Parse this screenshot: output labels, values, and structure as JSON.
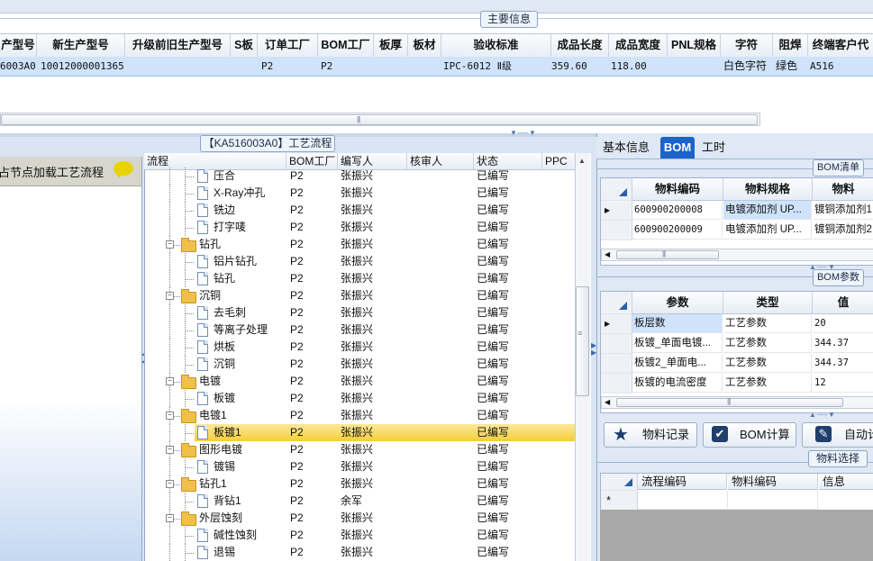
{
  "main_info": {
    "title": "主要信息",
    "columns": [
      "产型号",
      "新生产型号",
      "升级前旧生产型号",
      "S板",
      "订单工厂",
      "BOM工厂",
      "板厚",
      "板材",
      "验收标准",
      "成品长度",
      "成品宽度",
      "PNL规格",
      "字符",
      "阻焊",
      "终端客户代"
    ],
    "row": [
      "6003A0",
      "10012000001365",
      "",
      "",
      "P2",
      "P2",
      "",
      "",
      "IPC-6012 Ⅱ级",
      "359.60",
      "118.00",
      "",
      "白色字符",
      "绿色",
      "A516"
    ]
  },
  "left_nav": {
    "header": "占节点加载工艺流程",
    "chat_icon": "speech-bubble-icon"
  },
  "flow": {
    "title": "【KA516003A0】工艺流程",
    "columns": [
      "流程",
      "BOM工厂",
      "编写人",
      "核审人",
      "状态",
      "PPC"
    ],
    "rows": [
      {
        "name": "压合",
        "level": 2,
        "type": "doc",
        "factory": "P2",
        "author": "张振兴",
        "reviewer": "",
        "status": "已编写"
      },
      {
        "name": "X-Ray冲孔",
        "level": 2,
        "type": "doc",
        "factory": "P2",
        "author": "张振兴",
        "reviewer": "",
        "status": "已编写"
      },
      {
        "name": "铣边",
        "level": 2,
        "type": "doc",
        "factory": "P2",
        "author": "张振兴",
        "reviewer": "",
        "status": "已编写"
      },
      {
        "name": "打字唛",
        "level": 2,
        "type": "doc",
        "factory": "P2",
        "author": "张振兴",
        "reviewer": "",
        "status": "已编写"
      },
      {
        "name": "钻孔",
        "level": 1,
        "type": "folder",
        "factory": "P2",
        "author": "张振兴",
        "reviewer": "",
        "status": "已编写"
      },
      {
        "name": "铝片钻孔",
        "level": 2,
        "type": "doc",
        "factory": "P2",
        "author": "张振兴",
        "reviewer": "",
        "status": "已编写"
      },
      {
        "name": "钻孔",
        "level": 2,
        "type": "doc",
        "factory": "P2",
        "author": "张振兴",
        "reviewer": "",
        "status": "已编写"
      },
      {
        "name": "沉铜",
        "level": 1,
        "type": "folder",
        "factory": "P2",
        "author": "张振兴",
        "reviewer": "",
        "status": "已编写"
      },
      {
        "name": "去毛刺",
        "level": 2,
        "type": "doc",
        "factory": "P2",
        "author": "张振兴",
        "reviewer": "",
        "status": "已编写"
      },
      {
        "name": "等离子处理",
        "level": 2,
        "type": "doc",
        "factory": "P2",
        "author": "张振兴",
        "reviewer": "",
        "status": "已编写"
      },
      {
        "name": "烘板",
        "level": 2,
        "type": "doc",
        "factory": "P2",
        "author": "张振兴",
        "reviewer": "",
        "status": "已编写"
      },
      {
        "name": "沉铜",
        "level": 2,
        "type": "doc",
        "factory": "P2",
        "author": "张振兴",
        "reviewer": "",
        "status": "已编写"
      },
      {
        "name": "电镀",
        "level": 1,
        "type": "folder",
        "factory": "P2",
        "author": "张振兴",
        "reviewer": "",
        "status": "已编写"
      },
      {
        "name": "板镀",
        "level": 2,
        "type": "doc",
        "factory": "P2",
        "author": "张振兴",
        "reviewer": "",
        "status": "已编写"
      },
      {
        "name": "电镀1",
        "level": 1,
        "type": "folder",
        "factory": "P2",
        "author": "张振兴",
        "reviewer": "",
        "status": "已编写"
      },
      {
        "name": "板镀1",
        "level": 2,
        "type": "doc",
        "factory": "P2",
        "author": "张振兴",
        "reviewer": "",
        "status": "已编写",
        "selected": true
      },
      {
        "name": "图形电镀",
        "level": 1,
        "type": "folder",
        "factory": "P2",
        "author": "张振兴",
        "reviewer": "",
        "status": "已编写"
      },
      {
        "name": "镀锡",
        "level": 2,
        "type": "doc",
        "factory": "P2",
        "author": "张振兴",
        "reviewer": "",
        "status": "已编写"
      },
      {
        "name": "钻孔1",
        "level": 1,
        "type": "folder",
        "factory": "P2",
        "author": "张振兴",
        "reviewer": "",
        "status": "已编写"
      },
      {
        "name": "背钻1",
        "level": 2,
        "type": "doc",
        "factory": "P2",
        "author": "余军",
        "reviewer": "",
        "status": "已编写"
      },
      {
        "name": "外层蚀刻",
        "level": 1,
        "type": "folder",
        "factory": "P2",
        "author": "张振兴",
        "reviewer": "",
        "status": "已编写"
      },
      {
        "name": "碱性蚀刻",
        "level": 2,
        "type": "doc",
        "factory": "P2",
        "author": "张振兴",
        "reviewer": "",
        "status": "已编写"
      },
      {
        "name": "退锡",
        "level": 2,
        "type": "doc",
        "factory": "P2",
        "author": "张振兴",
        "reviewer": "",
        "status": "已编写"
      }
    ]
  },
  "right_panel": {
    "tabs": [
      "基本信息",
      "BOM",
      "工时"
    ],
    "active_tab": "BOM",
    "bom_list": {
      "title": "BOM清单",
      "columns": [
        "物料编码",
        "物料规格",
        "物料"
      ],
      "rows": [
        [
          "600900200008",
          "电镀添加剂 UP...",
          "镀铜添加剂1"
        ],
        [
          "600900200009",
          "电镀添加剂 UP...",
          "镀铜添加剂2"
        ]
      ]
    },
    "bom_params": {
      "title": "BOM参数",
      "columns": [
        "参数",
        "类型",
        "值"
      ],
      "rows": [
        [
          "板层数",
          "工艺参数",
          "20"
        ],
        [
          "板镀_单面电镀...",
          "工艺参数",
          "344.37"
        ],
        [
          "板镀2_单面电...",
          "工艺参数",
          "344.37"
        ],
        [
          "板镀的电流密度",
          "工艺参数",
          "12"
        ]
      ]
    },
    "buttons": [
      {
        "label": "物料记录",
        "icon": "star-icon"
      },
      {
        "label": "BOM计算",
        "icon": "checkbox-icon"
      },
      {
        "label": "自动计",
        "icon": "edit-icon"
      }
    ],
    "material_select": {
      "title": "物料选择",
      "columns": [
        "流程编码",
        "物料编码",
        "信息"
      ],
      "new_row_marker": "*"
    }
  },
  "colors": {
    "selection": "#cfe3fb",
    "tree_selected": "#f7d755",
    "tab_active": "#1d64c9"
  }
}
